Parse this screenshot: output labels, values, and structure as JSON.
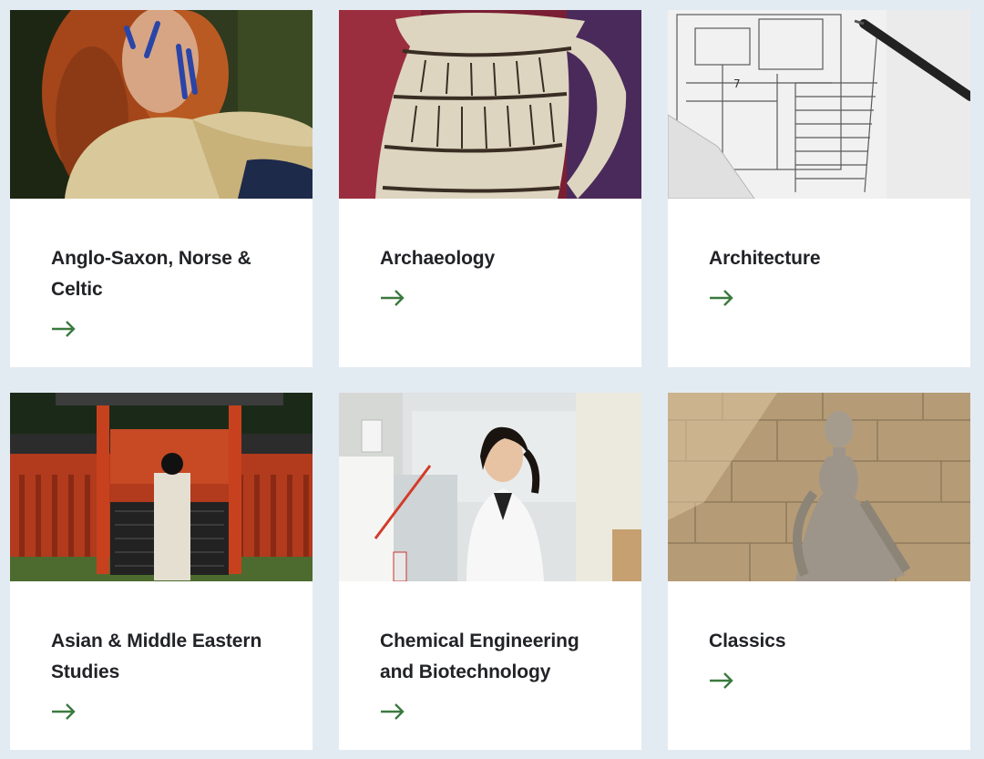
{
  "accent": "#3a7a3e",
  "cards": [
    {
      "title": "Anglo-Saxon, Norse & Celtic",
      "image": "woman-with-face-paint-photo",
      "icon": "arrow-right-icon"
    },
    {
      "title": "Archaeology",
      "image": "ancient-jug-photo",
      "icon": "arrow-right-icon"
    },
    {
      "title": "Architecture",
      "image": "architectural-plan-photo",
      "icon": "arrow-right-icon"
    },
    {
      "title": "Asian & Middle Eastern Studies",
      "image": "japanese-shrine-photo",
      "icon": "arrow-right-icon"
    },
    {
      "title": "Chemical Engineering and Biotechnology",
      "image": "scientist-in-lab-photo",
      "icon": "arrow-right-icon"
    },
    {
      "title": "Classics",
      "image": "roman-statue-photo",
      "icon": "arrow-right-icon"
    }
  ]
}
